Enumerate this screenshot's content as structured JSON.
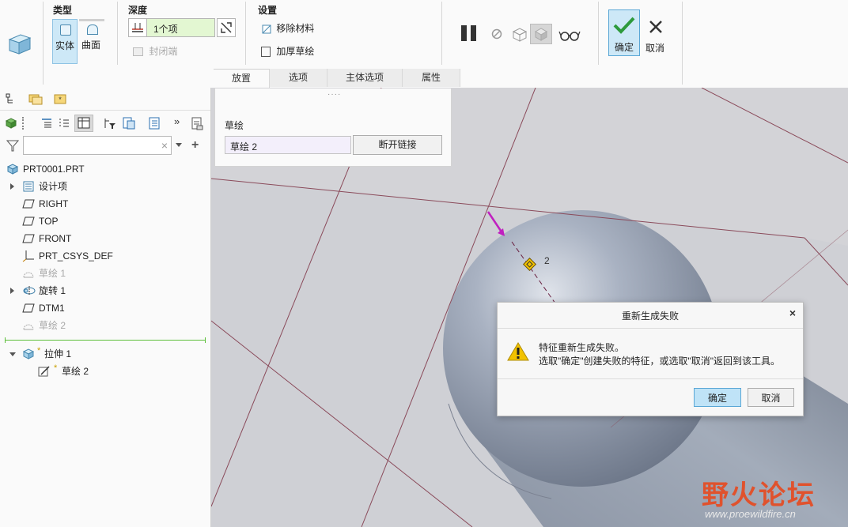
{
  "ribbon": {
    "type_group": {
      "title": "类型",
      "solid_label": "实体",
      "surface_label": "曲面"
    },
    "depth_group": {
      "title": "深度",
      "depth_value": "1个项",
      "closed_ends_label": "封闭端"
    },
    "settings_group": {
      "title": "设置",
      "remove_material_label": "移除材料",
      "thicken_sketch_label": "加厚草绘"
    },
    "ok_label": "确定",
    "cancel_label": "取消",
    "tabs": [
      {
        "label": "放置",
        "active": true
      },
      {
        "label": "选项",
        "active": false
      },
      {
        "label": "主体选项",
        "active": false
      },
      {
        "label": "属性",
        "active": false
      }
    ]
  },
  "placement_panel": {
    "section_label": "草绘",
    "sketch_value": "草绘 2",
    "unlink_button": "断开链接"
  },
  "model_tree": {
    "root": "PRT0001.PRT",
    "items": [
      {
        "label": "设计项",
        "icon": "design-items-icon",
        "expandable": true,
        "dim": false
      },
      {
        "label": "RIGHT",
        "icon": "datum-plane-icon",
        "expandable": false,
        "dim": false
      },
      {
        "label": "TOP",
        "icon": "datum-plane-icon",
        "expandable": false,
        "dim": false
      },
      {
        "label": "FRONT",
        "icon": "datum-plane-icon",
        "expandable": false,
        "dim": false
      },
      {
        "label": "PRT_CSYS_DEF",
        "icon": "csys-icon",
        "expandable": false,
        "dim": false
      },
      {
        "label": "草绘 1",
        "icon": "sketch-icon",
        "expandable": false,
        "dim": true
      },
      {
        "label": "旋转 1",
        "icon": "revolve-icon",
        "expandable": true,
        "dim": false
      },
      {
        "label": "DTM1",
        "icon": "datum-plane-icon",
        "expandable": false,
        "dim": false
      },
      {
        "label": "草绘 2",
        "icon": "sketch-icon",
        "expandable": false,
        "dim": true
      }
    ],
    "insert_feature": {
      "label": "拉伸 1",
      "child": "草绘 2"
    }
  },
  "viewport": {
    "dimension_label": "2"
  },
  "dialog": {
    "title": "重新生成失败",
    "line1": "特征重新生成失败。",
    "line2": "选取\"确定\"创建失败的特征，或选取\"取消\"返回到该工具。",
    "ok_label": "确定",
    "cancel_label": "取消"
  },
  "watermark": {
    "logo_text": "野火论坛",
    "url": "www.proewildfire.cn"
  },
  "colors": {
    "accent": "#5aa7d6",
    "selected_bg": "#cde8f7",
    "datum_line": "#8a4a5a",
    "warning": "#f2c200",
    "watermark": "#e0522d"
  }
}
